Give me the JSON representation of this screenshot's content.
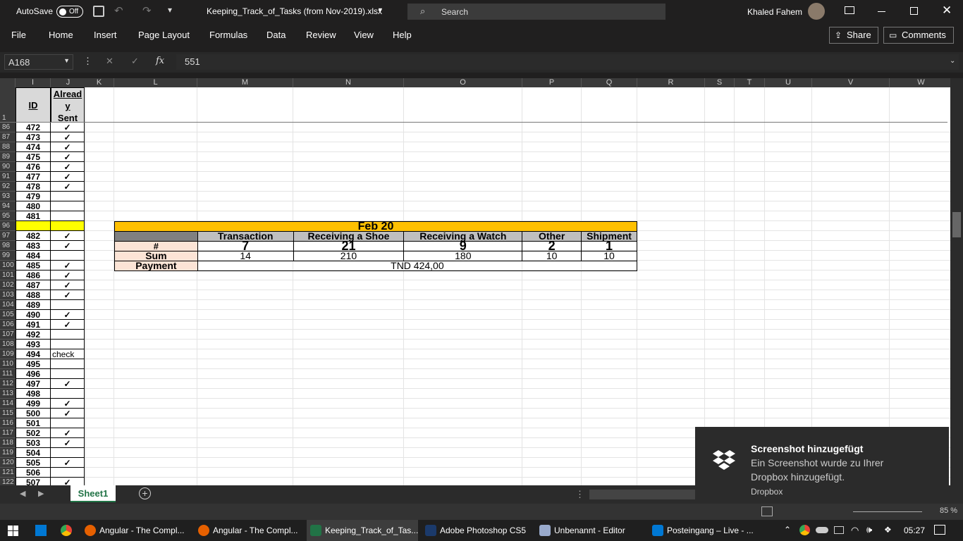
{
  "titlebar": {
    "autosave_label": "AutoSave",
    "autosave_state": "Off",
    "filename": "Keeping_Track_of_Tasks (from Nov-2019).xlsx",
    "search_placeholder": "Search",
    "user": "Khaled Fahem"
  },
  "menu": {
    "items": [
      "File",
      "Home",
      "Insert",
      "Page Layout",
      "Formulas",
      "Data",
      "Review",
      "View",
      "Help"
    ],
    "share": "Share",
    "comments": "Comments"
  },
  "formula_bar": {
    "name_box": "A168",
    "fx": "fx",
    "value": "551"
  },
  "columns": [
    "I",
    "J",
    "K",
    "L",
    "M",
    "N",
    "O",
    "P",
    "Q",
    "R",
    "S",
    "T",
    "U",
    "V",
    "W"
  ],
  "header_row": {
    "row_num": "1",
    "id_label": "ID",
    "sent_label_1": "Alread",
    "sent_label_2": "y",
    "sent_label_3": "Sent"
  },
  "rows": [
    {
      "r": "86",
      "id": "472",
      "s": "✓"
    },
    {
      "r": "87",
      "id": "473",
      "s": "✓"
    },
    {
      "r": "88",
      "id": "474",
      "s": "✓"
    },
    {
      "r": "89",
      "id": "475",
      "s": "✓"
    },
    {
      "r": "90",
      "id": "476",
      "s": "✓"
    },
    {
      "r": "91",
      "id": "477",
      "s": "✓"
    },
    {
      "r": "92",
      "id": "478",
      "s": "✓"
    },
    {
      "r": "93",
      "id": "479",
      "s": ""
    },
    {
      "r": "94",
      "id": "480",
      "s": ""
    },
    {
      "r": "95",
      "id": "481",
      "s": ""
    },
    {
      "r": "96",
      "id": "",
      "s": ""
    },
    {
      "r": "97",
      "id": "482",
      "s": "✓"
    },
    {
      "r": "98",
      "id": "483",
      "s": "✓"
    },
    {
      "r": "99",
      "id": "484",
      "s": ""
    },
    {
      "r": "100",
      "id": "485",
      "s": "✓"
    },
    {
      "r": "101",
      "id": "486",
      "s": "✓"
    },
    {
      "r": "102",
      "id": "487",
      "s": "✓"
    },
    {
      "r": "103",
      "id": "488",
      "s": "✓"
    },
    {
      "r": "104",
      "id": "489",
      "s": ""
    },
    {
      "r": "105",
      "id": "490",
      "s": "✓"
    },
    {
      "r": "106",
      "id": "491",
      "s": "✓"
    },
    {
      "r": "107",
      "id": "492",
      "s": ""
    },
    {
      "r": "108",
      "id": "493",
      "s": ""
    },
    {
      "r": "109",
      "id": "494",
      "s": "check"
    },
    {
      "r": "110",
      "id": "495",
      "s": ""
    },
    {
      "r": "111",
      "id": "496",
      "s": ""
    },
    {
      "r": "112",
      "id": "497",
      "s": "✓"
    },
    {
      "r": "113",
      "id": "498",
      "s": ""
    },
    {
      "r": "114",
      "id": "499",
      "s": "✓"
    },
    {
      "r": "115",
      "id": "500",
      "s": "✓"
    },
    {
      "r": "116",
      "id": "501",
      "s": ""
    },
    {
      "r": "117",
      "id": "502",
      "s": "✓"
    },
    {
      "r": "118",
      "id": "503",
      "s": "✓"
    },
    {
      "r": "119",
      "id": "504",
      "s": ""
    },
    {
      "r": "120",
      "id": "505",
      "s": "✓"
    },
    {
      "r": "121",
      "id": "506",
      "s": ""
    },
    {
      "r": "122",
      "id": "507",
      "s": "✓"
    }
  ],
  "summary": {
    "title": "Feb 20",
    "headers": [
      "Transaction",
      "Receiving a Shoe",
      "Receiving a Watch",
      "Other",
      "Shipment"
    ],
    "count_label": "#",
    "counts": [
      "7",
      "21",
      "9",
      "2",
      "1"
    ],
    "sum_label": "Sum",
    "sums": [
      "14",
      "210",
      "180",
      "10",
      "10"
    ],
    "payment_label": "Payment",
    "payment": "TND 424,00"
  },
  "sheet": {
    "tab": "Sheet1"
  },
  "status": {
    "zoom": "85 %"
  },
  "toast": {
    "title": "Screenshot hinzugefügt",
    "body1": "Ein Screenshot wurde zu Ihrer",
    "body2": "Dropbox hinzugefügt.",
    "app": "Dropbox"
  },
  "taskbar": {
    "apps": [
      "Angular - The Compl...",
      "Angular - The Compl...",
      "Keeping_Track_of_Tas...",
      "Adobe Photoshop CS5",
      "Unbenannt - Editor",
      "Posteingang – Live - ..."
    ],
    "time": "05:27"
  },
  "colors": {
    "yellow": "#ffff00",
    "orange": "#ffc000",
    "gray": "#bfbfbf",
    "pink": "#fce4d6",
    "excel_green": "#217346"
  }
}
